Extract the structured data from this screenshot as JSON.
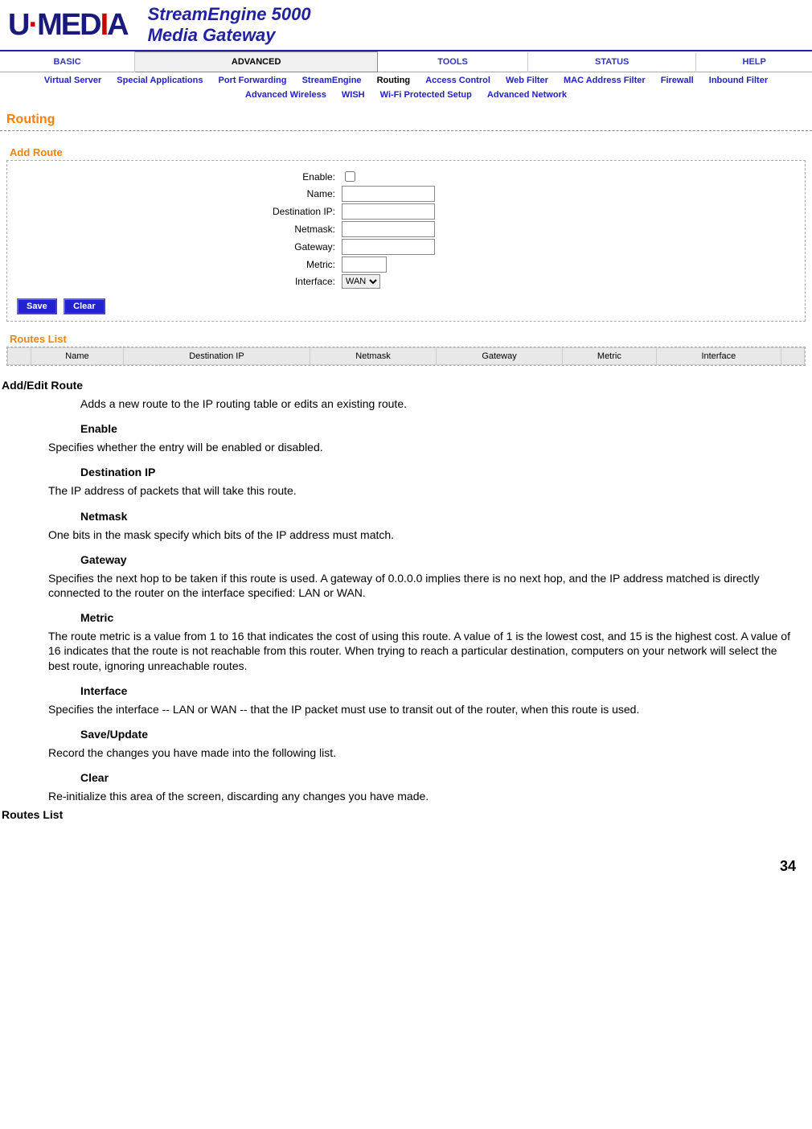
{
  "header": {
    "logo_text": "U·MEDIA",
    "product_line1": "StreamEngine 5000",
    "product_line2": "Media Gateway"
  },
  "main_nav": [
    "BASIC",
    "ADVANCED",
    "TOOLS",
    "STATUS",
    "HELP"
  ],
  "main_nav_active": "ADVANCED",
  "sub_nav_row1": [
    "Virtual Server",
    "Special Applications",
    "Port Forwarding",
    "StreamEngine",
    "Routing",
    "Access Control",
    "Web Filter",
    "MAC Address Filter",
    "Firewall",
    "Inbound Filter"
  ],
  "sub_nav_row2": [
    "Advanced Wireless",
    "WISH",
    "Wi-Fi Protected Setup",
    "Advanced Network"
  ],
  "sub_nav_active": "Routing",
  "section_title": "Routing",
  "add_route": {
    "title": "Add Route",
    "fields": {
      "enable": "Enable:",
      "name": "Name:",
      "dest_ip": "Destination IP:",
      "netmask": "Netmask:",
      "gateway": "Gateway:",
      "metric": "Metric:",
      "interface": "Interface:"
    },
    "interface_value": "WAN",
    "save_btn": "Save",
    "clear_btn": "Clear"
  },
  "routes_list": {
    "title": "Routes List",
    "cols": [
      "Name",
      "Destination IP",
      "Netmask",
      "Gateway",
      "Metric",
      "Interface"
    ]
  },
  "doc": {
    "h1": "Add/Edit Route",
    "p1": "Adds a new route to the IP routing table or edits an existing route.",
    "enable_h": "Enable",
    "enable_p": "Specifies whether the entry will be enabled or disabled.",
    "dest_h": "Destination IP",
    "dest_p": "The IP address of packets that will take this route.",
    "netmask_h": "Netmask",
    "netmask_p": "One bits in the mask specify which bits of the IP address must match.",
    "gateway_h": "Gateway",
    "gateway_p": "Specifies the next hop to be taken if this route is used. A gateway of 0.0.0.0 implies there is no next hop, and the IP address matched is directly connected to the router on the interface specified: LAN or WAN.",
    "metric_h": "Metric",
    "metric_p": "The route metric is a value from 1 to 16 that indicates the cost of using this route. A value of 1 is the lowest cost, and 15 is the highest cost. A value of 16 indicates that the route is not reachable from this router. When trying to reach a particular destination, computers on your network will select the best route, ignoring unreachable routes.",
    "interface_h": "Interface",
    "interface_p": "Specifies the interface -- LAN or WAN -- that the IP packet must use to transit out of the router, when this route is used.",
    "save_h": "Save/Update",
    "save_p": "Record the changes you have made into the following list.",
    "clear_h": "Clear",
    "clear_p": "Re-initialize this area of the screen, discarding any changes you have made.",
    "h2": "Routes List"
  },
  "page_number": "34"
}
